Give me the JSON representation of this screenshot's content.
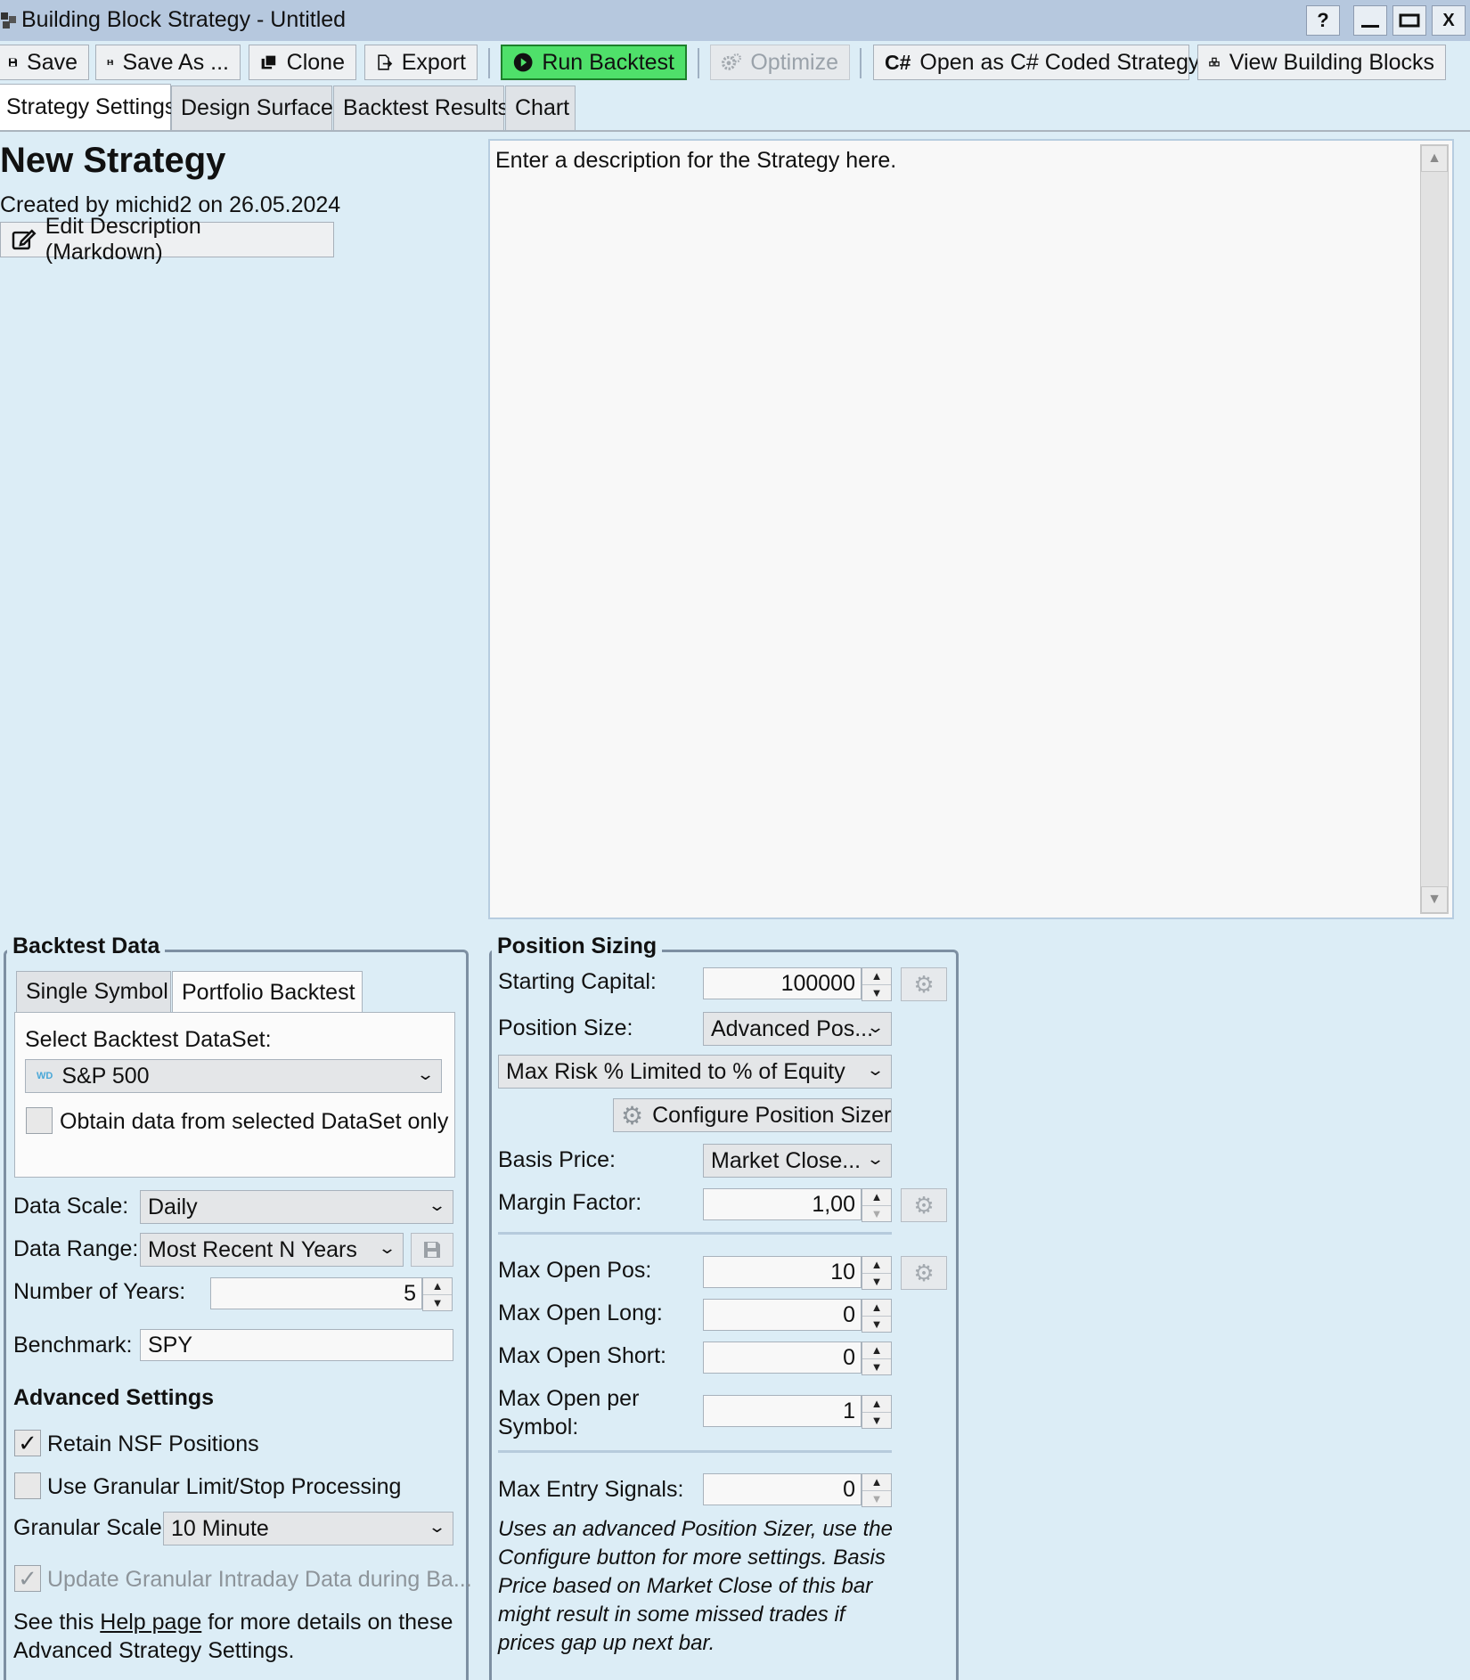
{
  "window": {
    "title": "Building Block Strategy - Untitled",
    "buttons": {
      "help": "?",
      "close": "X"
    }
  },
  "toolbar": {
    "save": "Save",
    "save_as": "Save As ...",
    "clone": "Clone",
    "export": "Export",
    "run_backtest": "Run Backtest",
    "optimize": "Optimize",
    "csharp_badge": "C#",
    "open_csharp": "Open as C# Coded Strategy",
    "view_blocks": "View Building Blocks"
  },
  "tabs": [
    {
      "label": "Strategy Settings",
      "active": true
    },
    {
      "label": "Design Surface"
    },
    {
      "label": "Backtest Results"
    },
    {
      "label": "Chart"
    }
  ],
  "strategy": {
    "title": "New Strategy",
    "created": "Created by michid2 on 26.05.2024",
    "edit_description": "Edit Description (Markdown)",
    "description": "Enter a description for the Strategy here."
  },
  "backtest_data": {
    "legend": "Backtest Data",
    "tabs": [
      "Single Symbol",
      "Portfolio Backtest"
    ],
    "select_dataset_label": "Select Backtest DataSet:",
    "dataset_badge": "WD",
    "dataset": "S&P 500",
    "obtain_only_label": "Obtain data from selected DataSet only",
    "obtain_only_checked": false,
    "data_scale_label": "Data Scale:",
    "data_scale": "Daily",
    "data_range_label": "Data Range:",
    "data_range": "Most Recent N Years",
    "num_years_label": "Number of Years:",
    "num_years": "5",
    "benchmark_label": "Benchmark:",
    "benchmark": "SPY"
  },
  "advanced": {
    "heading": "Advanced Settings",
    "retain_nsf": "Retain NSF Positions",
    "retain_nsf_checked": true,
    "granular_processing": "Use Granular Limit/Stop Processing",
    "granular_processing_checked": false,
    "granular_scale_label": "Granular Scale",
    "granular_scale": "10 Minute",
    "update_granular": "Update Granular Intraday Data during Ba...",
    "update_granular_checked": true,
    "help_prefix": "See this ",
    "help_link": "Help page",
    "help_suffix": " for more details on these",
    "help_line2": "Advanced Strategy Settings."
  },
  "position_sizing": {
    "legend": "Position Sizing",
    "starting_capital_label": "Starting Capital:",
    "starting_capital": "100000",
    "position_size_label": "Position Size:",
    "position_size": "Advanced Pos...",
    "sizer": "Max Risk % Limited to % of Equity",
    "configure_sizer": "Configure Position Sizer",
    "basis_price_label": "Basis Price:",
    "basis_price": "Market Close...",
    "margin_factor_label": "Margin Factor:",
    "margin_factor": "1,00",
    "max_open_pos_label": "Max Open Pos:",
    "max_open_pos": "10",
    "max_open_long_label": "Max Open Long:",
    "max_open_long": "0",
    "max_open_short_label": "Max Open Short:",
    "max_open_short": "0",
    "max_open_per_symbol_label_1": "Max Open per",
    "max_open_per_symbol_label_2": "Symbol:",
    "max_open_per_symbol": "1",
    "max_entry_signals_label": "Max Entry Signals:",
    "max_entry_signals": "0",
    "note_lines": [
      "Uses an advanced Position Sizer, use the",
      "Configure button for more settings. Basis",
      "Price based on Market Close of this bar",
      "might result in some missed trades if",
      "prices gap up next bar."
    ]
  },
  "colors": {
    "background": "#dcedf6",
    "titlebar": "#b6c8de",
    "run_button": "#4fe06a"
  }
}
